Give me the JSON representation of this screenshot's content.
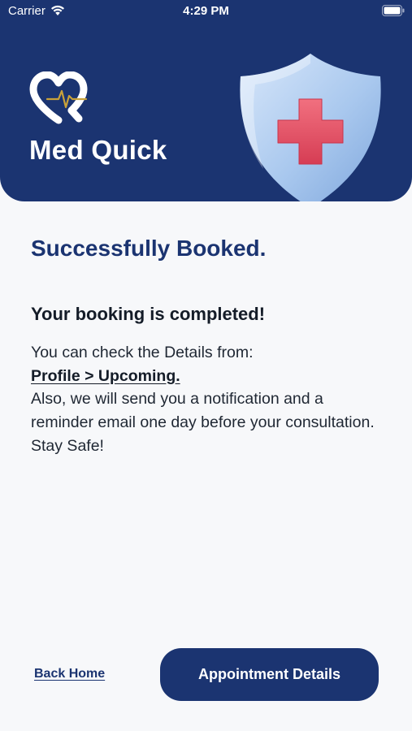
{
  "status_bar": {
    "carrier": "Carrier",
    "time": "4:29 PM",
    "wifi_icon": "wifi-icon",
    "battery_icon": "battery-icon"
  },
  "header": {
    "logo_text": "Med Quick",
    "logo_icon": "heart-pulse-logo",
    "illustration": "shield-plus-icon",
    "colors": {
      "brand": "#1b3471",
      "accent_cross": "#e04a5f",
      "shield": "#a9c8ee",
      "pulse": "#c9a23a"
    }
  },
  "content": {
    "title": "Successfully Booked.",
    "heading": "Your booking is completed!",
    "line1": "You can check the Details from:",
    "link": "Profile > Upcoming.",
    "line2": "Also, we will send you a notification and a reminder email one day before your consultation.",
    "line3": "Stay Safe!"
  },
  "actions": {
    "back_home": "Back Home",
    "appointment_details": "Appointment Details"
  }
}
